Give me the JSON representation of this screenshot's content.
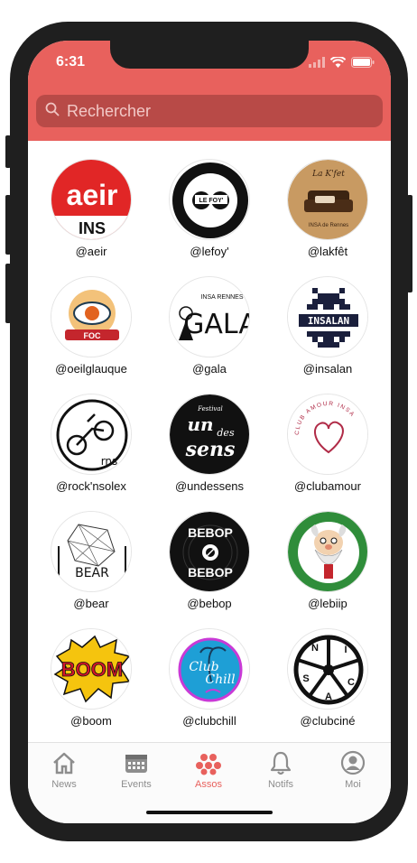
{
  "status_bar": {
    "time": "6:31"
  },
  "search": {
    "placeholder": "Rechercher"
  },
  "accent_color": "#e8615d",
  "associations": [
    {
      "handle": "@aeir"
    },
    {
      "handle": "@lefoy'"
    },
    {
      "handle": "@lakfêt"
    },
    {
      "handle": "@oeilglauque"
    },
    {
      "handle": "@gala"
    },
    {
      "handle": "@insalan"
    },
    {
      "handle": "@rock'nsolex"
    },
    {
      "handle": "@undessens"
    },
    {
      "handle": "@clubamour"
    },
    {
      "handle": "@bear"
    },
    {
      "handle": "@bebop"
    },
    {
      "handle": "@lebiip"
    },
    {
      "handle": "@boom"
    },
    {
      "handle": "@clubchill"
    },
    {
      "handle": "@clubciné"
    }
  ],
  "logo_text": {
    "aeir": "aeir",
    "aeir_sub": "INS",
    "lefoy": "LE FOY'",
    "lakfet": "La K'fet",
    "lakfet_sub": "INSA de Rennes",
    "foc": "FOC",
    "gala": "GALA",
    "gala_top": "INSA RENNES",
    "insalan": "INSALAN",
    "rns": "rns",
    "undessens_1": "un",
    "undessens_2": "des",
    "undessens_3": "sens",
    "undessens_top": "Festival",
    "clubamour_ring": "CLUB AMOUR INSA",
    "bear": "BEAR",
    "bebop_top": "BEBOP",
    "bebop_bottom": "BEBOP",
    "boom": "BOOM",
    "clubchill_1": "Club",
    "clubchill_2": "Chill",
    "clubciné_letters": [
      "N",
      "I",
      "C",
      "S",
      "A"
    ]
  },
  "tabs": [
    {
      "label": "News",
      "icon": "house-icon",
      "active": false
    },
    {
      "label": "Events",
      "icon": "calendar-icon",
      "active": false
    },
    {
      "label": "Assos",
      "icon": "people-dots-icon",
      "active": true
    },
    {
      "label": "Notifs",
      "icon": "bell-icon",
      "active": false
    },
    {
      "label": "Moi",
      "icon": "user-icon",
      "active": false
    }
  ]
}
